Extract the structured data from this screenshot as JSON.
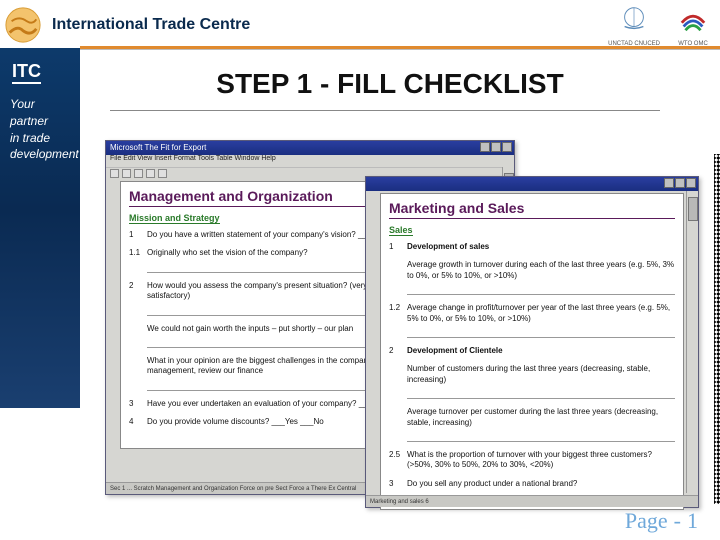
{
  "header": {
    "brand": "International Trade Centre",
    "partners": [
      {
        "id": "unctad",
        "label": "UNCTAD CNUCED"
      },
      {
        "id": "wto",
        "label": "WTO OMC"
      }
    ]
  },
  "sidebar": {
    "mark": "ITC",
    "tagline_lines": [
      "Your partner",
      "in trade",
      "development"
    ]
  },
  "heading": "STEP 1 - FILL CHECKLIST",
  "window_back": {
    "title": "Microsoft The Fit for Export",
    "menu": "File  Edit  View  Insert  Format  Tools  Table  Window  Help",
    "section": "Management and Organization",
    "subsection": "Mission and Strategy",
    "questions": [
      {
        "n": "1",
        "t": "Do you have a written statement of your company's vision?   ___Yes ___No"
      },
      {
        "n": "1.1",
        "t": "Originally who set the vision of the company?"
      },
      {
        "n": "2",
        "t": "How would you assess the company's present situation?  (very poor, poor, satisfactory, very satisfactory)"
      },
      {
        "n": "",
        "t": "We could not gain worth the inputs – put shortly – our plan"
      },
      {
        "n": "",
        "t": "What in your opinion are the biggest challenges in the company?  review our structure, our management, review our finance"
      },
      {
        "n": "3",
        "t": "Have you ever undertaken an evaluation of your company?   ___Yes ___No"
      },
      {
        "n": "4",
        "t": "Do you provide volume discounts?   ___Yes ___No"
      }
    ],
    "status": "Sec 1 ... Scratch   Management and Organization   Force on pre Sect   Force a There Ex  Central"
  },
  "window_front": {
    "title": "",
    "section": "Marketing and Sales",
    "subsection": "Sales",
    "questions": [
      {
        "n": "1",
        "t": "Development of sales"
      },
      {
        "n": "",
        "t": "Average growth in turnover during each of the last three years  (e.g. 5%, 3% to 0%, or 5% to 10%, or >10%)"
      },
      {
        "n": "1.2",
        "t": "Average change in profit/turnover per year of the last three years  (e.g. 5%, 5% to 0%, or 5% to 10%, or >10%)"
      },
      {
        "n": "2",
        "t": "Development of Clientele"
      },
      {
        "n": "",
        "t": "Number of customers during the last three years  (decreasing, stable, increasing)"
      },
      {
        "n": "",
        "t": "Average turnover per customer during the last three years  (decreasing, stable, increasing)"
      },
      {
        "n": "2.5",
        "t": "What is the proportion of turnover with your biggest three customers?  (>50%, 30% to 50%, 20% to 30%, <20%)"
      },
      {
        "n": "3",
        "t": "Do you sell any product under a national brand?"
      }
    ],
    "status": "Marketing and sales   6"
  },
  "footer": {
    "page_word": "Page",
    "page_no": "1"
  }
}
